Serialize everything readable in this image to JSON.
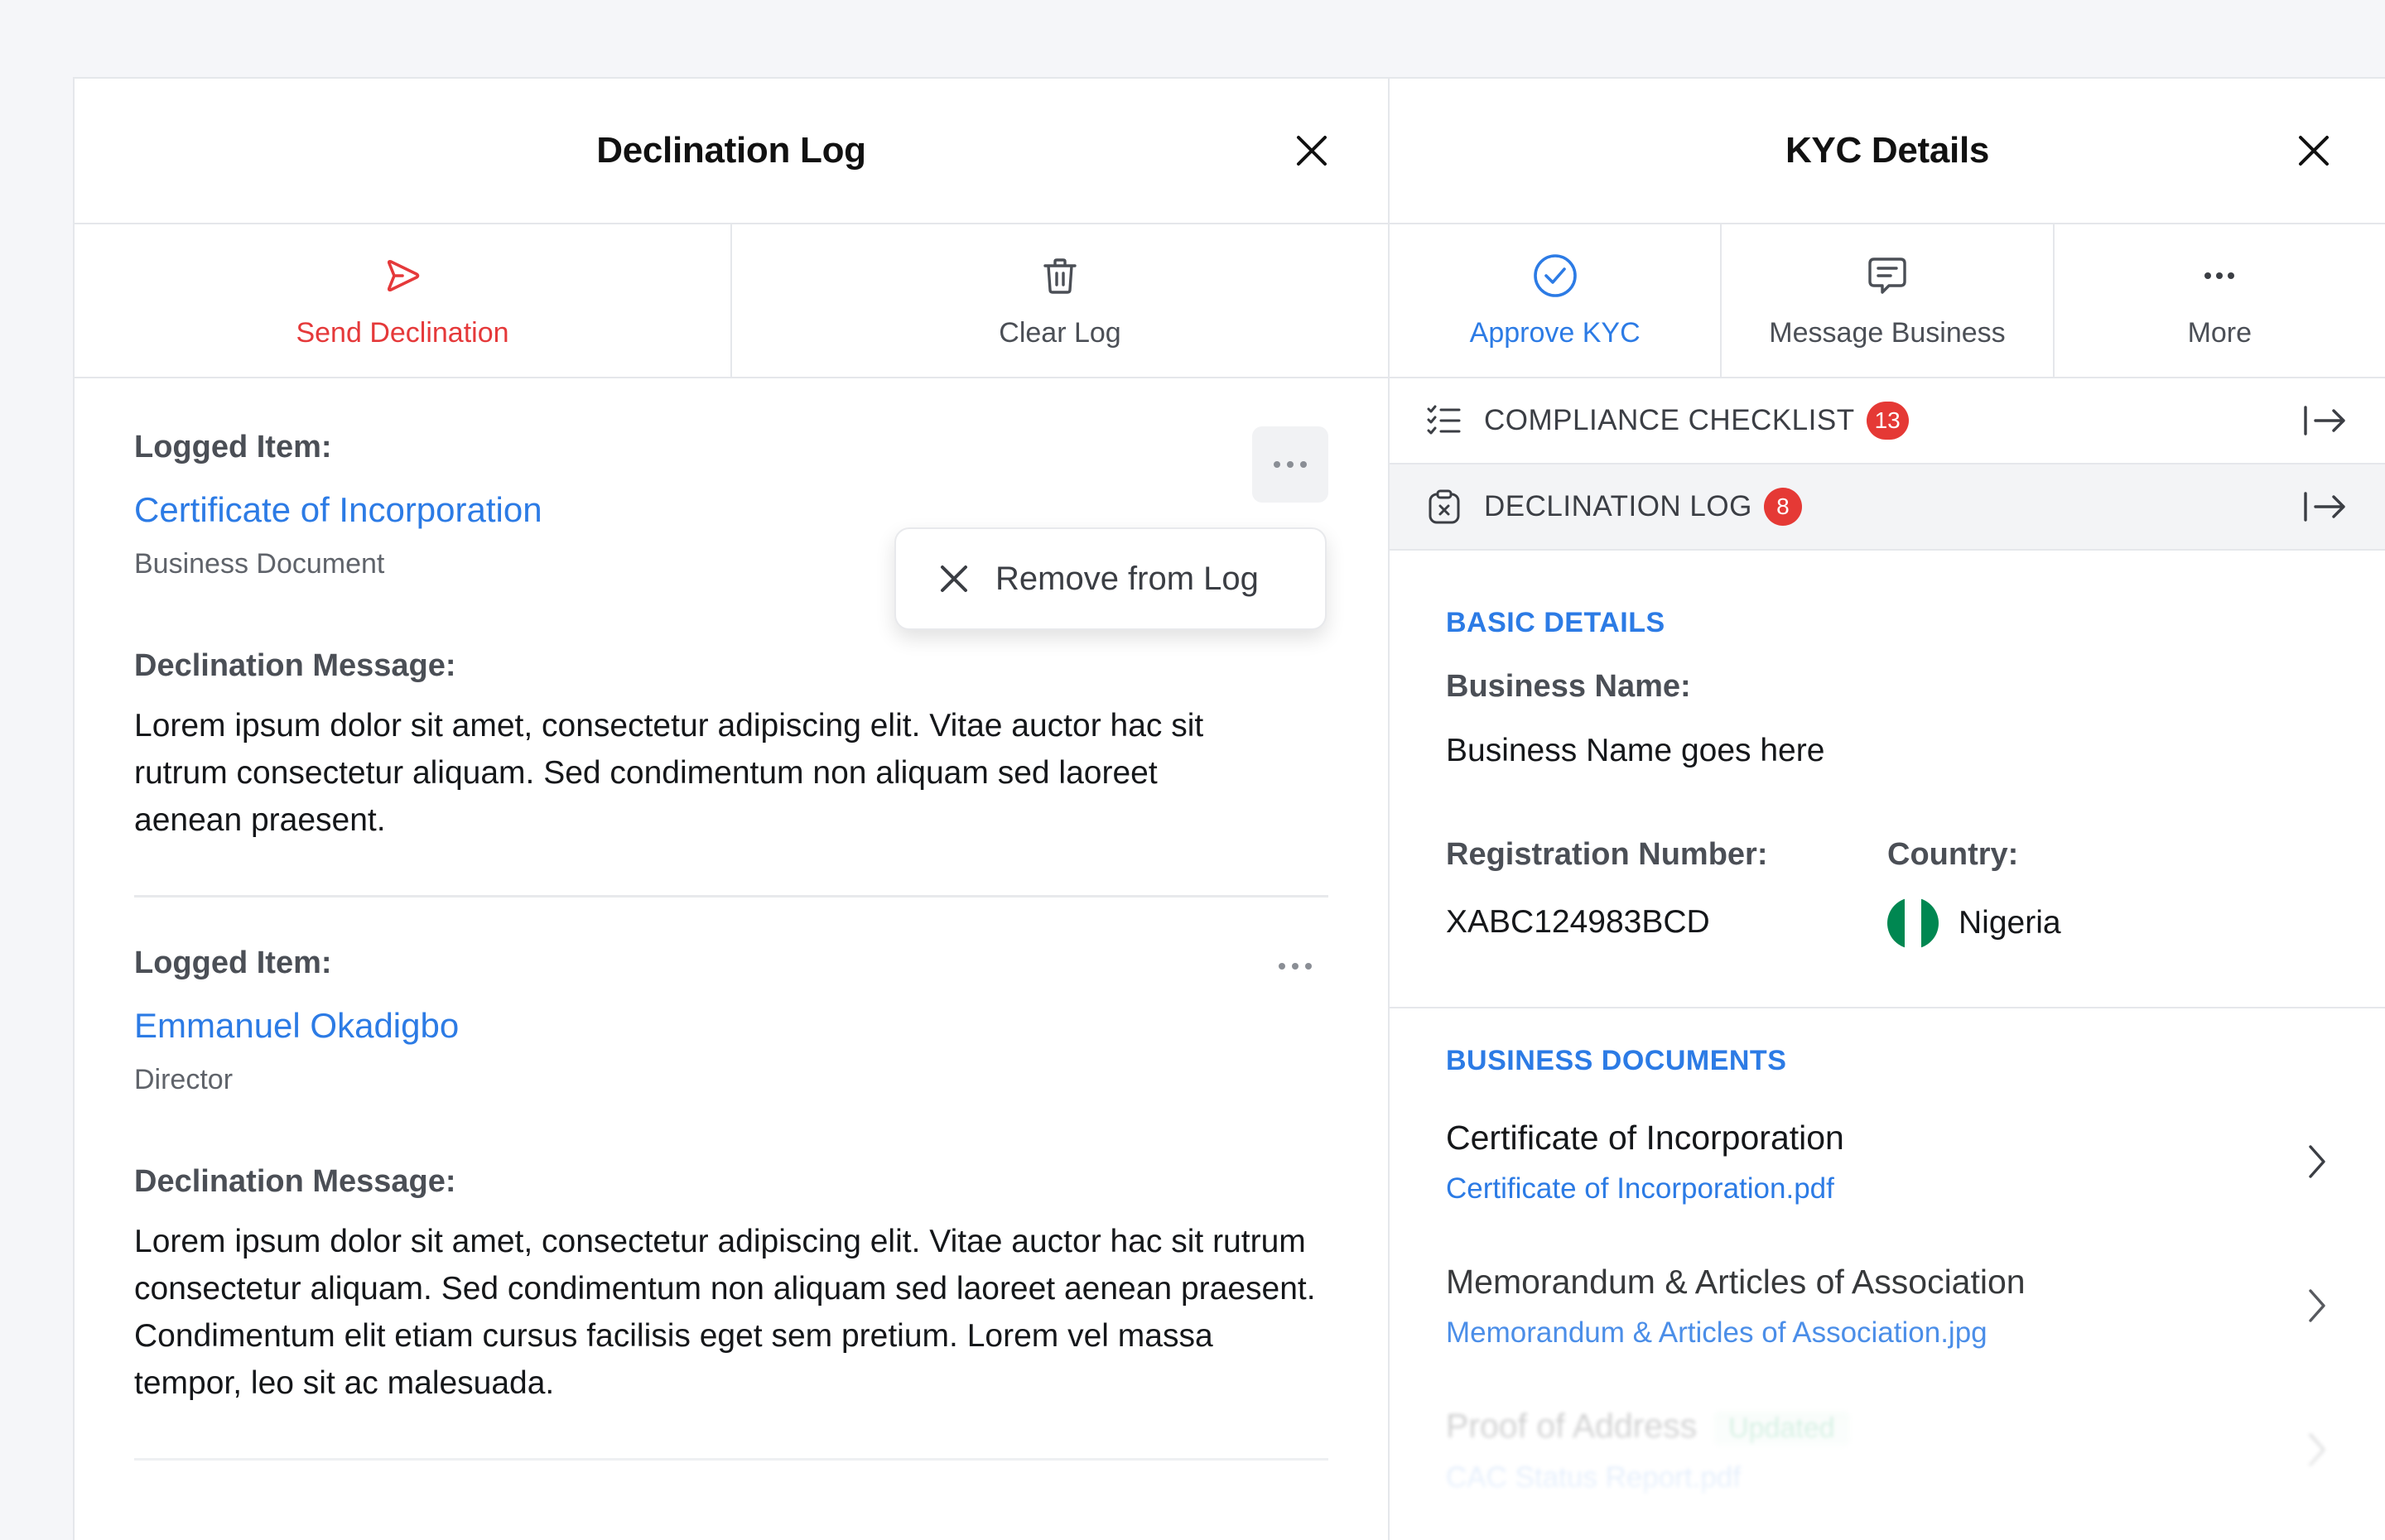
{
  "left_panel": {
    "title": "Declination Log",
    "actions": {
      "send_label": "Send Declination",
      "clear_label": "Clear Log"
    },
    "items": [
      {
        "label": "Logged Item:",
        "name": "Certificate of Incorporation",
        "type": "Business Document",
        "message_label": "Declination Message:",
        "message": "Lorem ipsum dolor sit amet, consectetur adipiscing elit. Vitae auctor hac sit rutrum consectetur aliquam. Sed condimentum non aliquam sed laoreet aenean praesent."
      },
      {
        "label": "Logged Item:",
        "name": "Emmanuel Okadigbo",
        "type": "Director",
        "message_label": "Declination Message:",
        "message": "Lorem ipsum dolor sit amet, consectetur adipiscing elit. Vitae auctor hac sit rutrum consectetur aliquam. Sed condimentum non aliquam sed laoreet aenean praesent. Condimentum elit etiam cursus facilisis eget sem pretium. Lorem vel massa tempor, leo sit ac malesuada."
      }
    ],
    "menu": {
      "remove_label": "Remove from Log"
    }
  },
  "right_panel": {
    "title": "KYC Details",
    "actions": {
      "approve_label": "Approve KYC",
      "message_label": "Message Business",
      "more_label": "More"
    },
    "strips": {
      "compliance_label": "COMPLIANCE CHECKLIST",
      "compliance_count": "13",
      "declination_label": "DECLINATION LOG",
      "declination_count": "8"
    },
    "basic": {
      "section_title": "BASIC DETAILS",
      "business_name_label": "Business Name:",
      "business_name_value": "Business Name goes here",
      "reg_label": "Registration Number:",
      "reg_value": "XABC124983BCD",
      "country_label": "Country:",
      "country_value": "Nigeria"
    },
    "docs": {
      "section_title": "BUSINESS DOCUMENTS",
      "items": [
        {
          "title": "Certificate of Incorporation",
          "file": "Certificate of Incorporation.pdf"
        },
        {
          "title": "Memorandum & Articles of Association",
          "file": "Memorandum & Articles of Association.jpg"
        },
        {
          "title": "Proof of Address",
          "file": "CAC Status Report.pdf",
          "tag": "Updated"
        }
      ]
    }
  },
  "colors": {
    "accent_blue": "#2c7be5",
    "danger_red": "#e5393a",
    "badge_red": "#e53935",
    "flag_green": "#008751"
  }
}
